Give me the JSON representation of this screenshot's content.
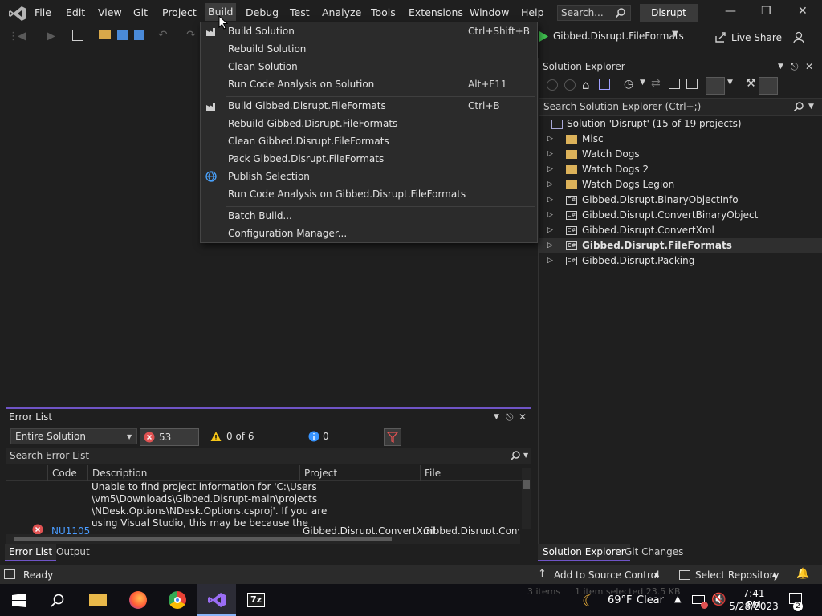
{
  "menu": {
    "items": [
      "File",
      "Edit",
      "View",
      "Git",
      "Project",
      "Build",
      "Debug",
      "Test",
      "Analyze",
      "Tools",
      "Extensions",
      "Window",
      "Help"
    ],
    "active": "Build"
  },
  "title": {
    "search_placeholder": "Search...",
    "solution_name": "Disrupt"
  },
  "toolbar": {
    "startup_project": "Gibbed.Disrupt.FileFormats",
    "live_share": "Live Share"
  },
  "build_menu": {
    "build_solution": {
      "label": "Build Solution",
      "shortcut": "Ctrl+Shift+B"
    },
    "rebuild_solution": {
      "label": "Rebuild Solution"
    },
    "clean_solution": {
      "label": "Clean Solution"
    },
    "run_code_analysis_solution": {
      "label": "Run Code Analysis on Solution",
      "shortcut": "Alt+F11"
    },
    "build_project": {
      "label": "Build Gibbed.Disrupt.FileFormats",
      "shortcut": "Ctrl+B"
    },
    "rebuild_project": {
      "label": "Rebuild Gibbed.Disrupt.FileFormats"
    },
    "clean_project": {
      "label": "Clean Gibbed.Disrupt.FileFormats"
    },
    "pack_project": {
      "label": "Pack Gibbed.Disrupt.FileFormats"
    },
    "publish_selection": {
      "label": "Publish Selection"
    },
    "run_code_analysis_project": {
      "label": "Run Code Analysis on Gibbed.Disrupt.FileFormats"
    },
    "batch_build": {
      "label": "Batch Build..."
    },
    "configuration_manager": {
      "label": "Configuration Manager..."
    }
  },
  "solution_explorer": {
    "title": "Solution Explorer",
    "search_placeholder": "Search Solution Explorer (Ctrl+;)",
    "root": "Solution 'Disrupt' (15 of 19 projects)",
    "items": [
      {
        "label": "Misc",
        "icon": "folder-icon"
      },
      {
        "label": "Watch Dogs",
        "icon": "folder-icon"
      },
      {
        "label": "Watch Dogs 2",
        "icon": "folder-icon"
      },
      {
        "label": "Watch Dogs Legion",
        "icon": "folder-icon"
      },
      {
        "label": "Gibbed.Disrupt.BinaryObjectInfo",
        "icon": "csharp-project-icon"
      },
      {
        "label": "Gibbed.Disrupt.ConvertBinaryObject",
        "icon": "csharp-project-icon"
      },
      {
        "label": "Gibbed.Disrupt.ConvertXml",
        "icon": "csharp-project-icon"
      },
      {
        "label": "Gibbed.Disrupt.FileFormats",
        "icon": "csharp-project-icon",
        "selected": true
      },
      {
        "label": "Gibbed.Disrupt.Packing",
        "icon": "csharp-project-icon"
      }
    ],
    "tabs": [
      "Solution Explorer",
      "Git Changes"
    ]
  },
  "error_list": {
    "title": "Error List",
    "scope": "Entire Solution",
    "errors_label": "53 Errors",
    "warnings_label": "0 of 6 Warnings",
    "messages_label": "0 Messages",
    "search_placeholder": "Search Error List",
    "columns": [
      "Code",
      "Description",
      "Project",
      "File"
    ],
    "row": {
      "code": "NU1105",
      "description_lines": [
        "Unable to find project information for 'C:\\Users",
        "\\vm5\\Downloads\\Gibbed.Disrupt-main\\projects",
        "\\NDesk.Options\\NDesk.Options.csproj'. If you are",
        "using Visual Studio, this may be because the"
      ],
      "project": "Gibbed.Disrupt.ConvertXml",
      "file": "Gibbed.Disrupt.Conver"
    },
    "tabs": [
      "Error List",
      "Output"
    ]
  },
  "status": {
    "ready": "Ready",
    "source_control": "Add to Source Control",
    "repository": "Select Repository"
  },
  "taskbar": {
    "weather_temp": "69°F",
    "weather_desc": "Clear",
    "time": "7:41 PM",
    "date": "5/28/2023",
    "overlay_left": "3 items",
    "overlay_right": "1 item selected  23.5 KB",
    "notification_count": "2"
  },
  "colors": {
    "accent": "#6f54c6",
    "error": "#e05252",
    "warning": "#f5c518",
    "info": "#3794ff"
  }
}
